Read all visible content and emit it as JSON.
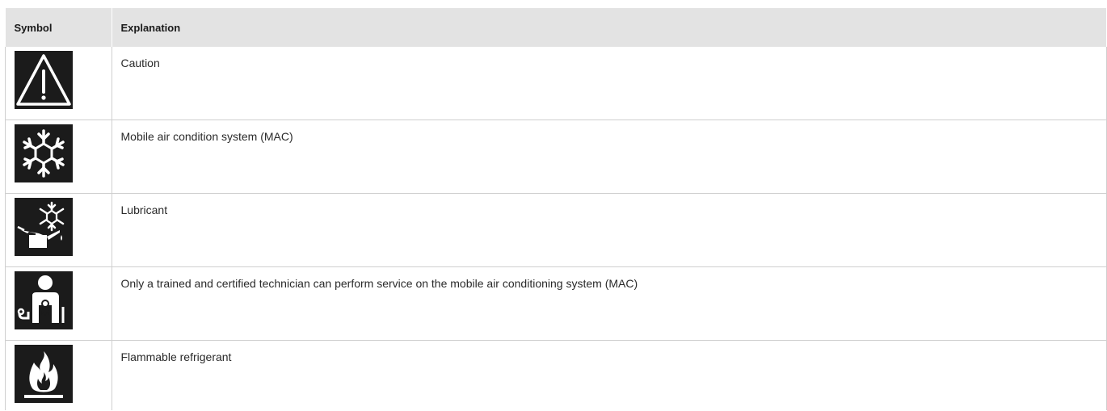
{
  "table": {
    "headers": {
      "symbol": "Symbol",
      "explanation": "Explanation"
    },
    "rows": [
      {
        "icon": "caution-triangle-icon",
        "explanation": "Caution"
      },
      {
        "icon": "snowflake-icon",
        "explanation": "Mobile air condition system (MAC)"
      },
      {
        "icon": "oil-can-snowflake-icon",
        "explanation": "Lubricant"
      },
      {
        "icon": "certified-technician-icon",
        "explanation": "Only a trained and certified technician can perform service on the mobile air conditioning system (MAC)"
      },
      {
        "icon": "flame-icon",
        "explanation": "Flammable refrigerant"
      }
    ]
  },
  "colors": {
    "header_bg": "#e3e3e3",
    "icon_bg": "#1b1b1b",
    "icon_fg": "#ffffff",
    "grid": "#cfcfcf"
  }
}
